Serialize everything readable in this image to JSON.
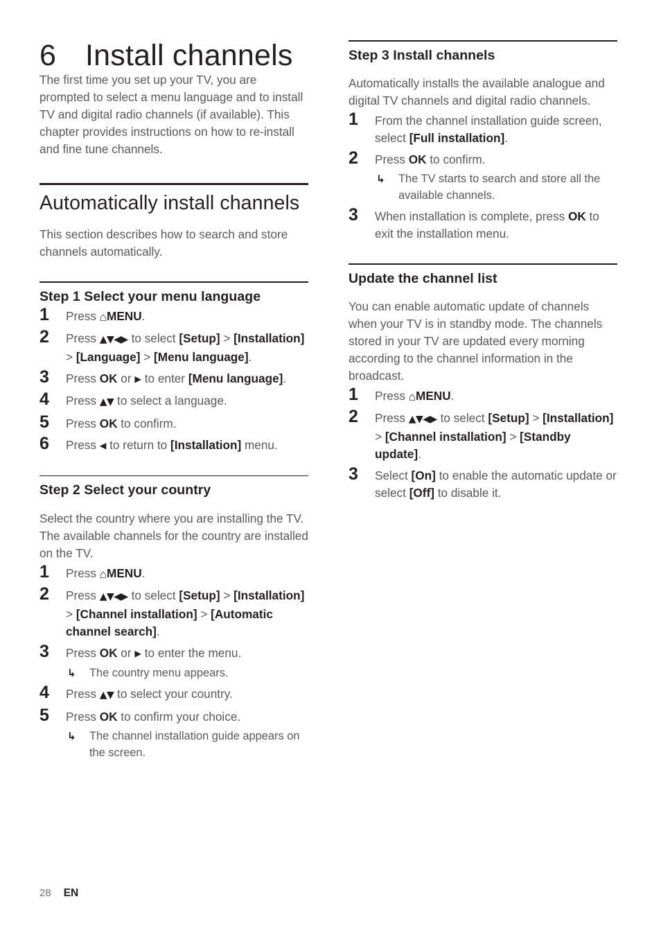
{
  "document": {
    "chapter_number": "6",
    "chapter_title": "Install channels",
    "intro": "The first time you set up your TV, you are prompted to select a menu language and to install TV and digital radio channels (if available). This chapter provides instructions on how to re-install and fine tune channels."
  },
  "glyphs": {
    "home": "⌂",
    "home_label": "home-icon",
    "updown": "▲▼",
    "updownleftright": "▲▼◀▶",
    "right": "▶",
    "left": "◀",
    "result_arrow": "↳"
  },
  "left_column": {
    "section": {
      "title": "Automatically install channels",
      "intro": "This section describes how to search and store channels automatically."
    },
    "step1": {
      "heading": "Step 1 Select your menu language",
      "items": [
        {
          "num": "1",
          "parts": [
            {
              "t": "text",
              "v": "Press "
            },
            {
              "t": "home",
              "v": "⌂"
            },
            {
              "t": "bold",
              "v": "MENU"
            },
            {
              "t": "text",
              "v": "."
            }
          ]
        },
        {
          "num": "2",
          "parts": [
            {
              "t": "text",
              "v": "Press "
            },
            {
              "t": "glyph",
              "v": "▲▼◀▶"
            },
            {
              "t": "text",
              "v": " to select "
            },
            {
              "t": "bold",
              "v": "[Setup]"
            },
            {
              "t": "text",
              "v": " > "
            },
            {
              "t": "bold",
              "v": "[Installation]"
            },
            {
              "t": "text",
              "v": " > "
            },
            {
              "t": "bold",
              "v": "[Language]"
            },
            {
              "t": "text",
              "v": " > "
            },
            {
              "t": "bold",
              "v": "[Menu language]"
            },
            {
              "t": "text",
              "v": "."
            }
          ]
        },
        {
          "num": "3",
          "parts": [
            {
              "t": "text",
              "v": "Press "
            },
            {
              "t": "bold",
              "v": "OK"
            },
            {
              "t": "text",
              "v": " or "
            },
            {
              "t": "glyph-single",
              "v": "▶"
            },
            {
              "t": "text",
              "v": " to enter "
            },
            {
              "t": "bold",
              "v": "[Menu language]"
            },
            {
              "t": "text",
              "v": "."
            }
          ]
        },
        {
          "num": "4",
          "parts": [
            {
              "t": "text",
              "v": "Press "
            },
            {
              "t": "glyph",
              "v": "▲▼"
            },
            {
              "t": "text",
              "v": " to select a language."
            }
          ]
        },
        {
          "num": "5",
          "parts": [
            {
              "t": "text",
              "v": "Press "
            },
            {
              "t": "bold",
              "v": "OK"
            },
            {
              "t": "text",
              "v": " to confirm."
            }
          ]
        },
        {
          "num": "6",
          "parts": [
            {
              "t": "text",
              "v": "Press "
            },
            {
              "t": "glyph-single",
              "v": "◀"
            },
            {
              "t": "text",
              "v": " to return to "
            },
            {
              "t": "bold",
              "v": "[Installation]"
            },
            {
              "t": "text",
              "v": " menu."
            }
          ]
        }
      ]
    },
    "step2": {
      "heading": "Step 2 Select your country",
      "intro": "Select the country where you are installing the TV. The available channels for the country are installed on the TV.",
      "items": [
        {
          "num": "1",
          "parts": [
            {
              "t": "text",
              "v": "Press "
            },
            {
              "t": "home",
              "v": "⌂"
            },
            {
              "t": "bold",
              "v": "MENU"
            },
            {
              "t": "text",
              "v": "."
            }
          ]
        },
        {
          "num": "2",
          "parts": [
            {
              "t": "text",
              "v": "Press "
            },
            {
              "t": "glyph",
              "v": "▲▼◀▶"
            },
            {
              "t": "text",
              "v": " to select "
            },
            {
              "t": "bold",
              "v": "[Setup]"
            },
            {
              "t": "text",
              "v": " > "
            },
            {
              "t": "bold",
              "v": "[Installation]"
            },
            {
              "t": "text",
              "v": " > "
            },
            {
              "t": "bold",
              "v": "[Channel installation]"
            },
            {
              "t": "text",
              "v": " > "
            },
            {
              "t": "bold",
              "v": "[Automatic channel search]"
            },
            {
              "t": "text",
              "v": "."
            }
          ]
        },
        {
          "num": "3",
          "parts": [
            {
              "t": "text",
              "v": "Press "
            },
            {
              "t": "bold",
              "v": "OK"
            },
            {
              "t": "text",
              "v": " or "
            },
            {
              "t": "glyph-single",
              "v": "▶"
            },
            {
              "t": "text",
              "v": " to enter the menu."
            }
          ],
          "results": [
            "The country menu appears."
          ]
        },
        {
          "num": "4",
          "parts": [
            {
              "t": "text",
              "v": "Press "
            },
            {
              "t": "glyph",
              "v": "▲▼"
            },
            {
              "t": "text",
              "v": " to select your country."
            }
          ]
        },
        {
          "num": "5",
          "parts": [
            {
              "t": "text",
              "v": "Press "
            },
            {
              "t": "bold",
              "v": "OK"
            },
            {
              "t": "text",
              "v": " to confirm your choice."
            }
          ],
          "results": [
            "The channel installation guide appears on the screen."
          ]
        }
      ]
    }
  },
  "right_column": {
    "step3": {
      "heading": "Step 3 Install channels",
      "intro": "Automatically installs the available analogue and digital TV channels and digital radio channels.",
      "items": [
        {
          "num": "1",
          "parts": [
            {
              "t": "text",
              "v": "From the channel installation guide screen, select "
            },
            {
              "t": "bold",
              "v": "[Full installation]"
            },
            {
              "t": "text",
              "v": "."
            }
          ]
        },
        {
          "num": "2",
          "parts": [
            {
              "t": "text",
              "v": "Press "
            },
            {
              "t": "bold",
              "v": "OK"
            },
            {
              "t": "text",
              "v": " to confirm."
            }
          ],
          "results": [
            "The TV starts to search and store all the available channels."
          ]
        },
        {
          "num": "3",
          "parts": [
            {
              "t": "text",
              "v": "When installation is complete, press "
            },
            {
              "t": "bold",
              "v": "OK"
            },
            {
              "t": "text",
              "v": " to exit the installation menu."
            }
          ]
        }
      ]
    },
    "update": {
      "heading": "Update the channel list",
      "intro": "You can enable automatic update of channels when your TV is in standby mode. The channels stored in your TV are updated every morning according to the channel information in the broadcast.",
      "items": [
        {
          "num": "1",
          "parts": [
            {
              "t": "text",
              "v": "Press "
            },
            {
              "t": "home",
              "v": "⌂"
            },
            {
              "t": "bold",
              "v": "MENU"
            },
            {
              "t": "text",
              "v": "."
            }
          ]
        },
        {
          "num": "2",
          "parts": [
            {
              "t": "text",
              "v": "Press "
            },
            {
              "t": "glyph",
              "v": "▲▼◀▶"
            },
            {
              "t": "text",
              "v": " to select "
            },
            {
              "t": "bold",
              "v": "[Setup]"
            },
            {
              "t": "text",
              "v": " > "
            },
            {
              "t": "bold",
              "v": "[Installation]"
            },
            {
              "t": "text",
              "v": " > "
            },
            {
              "t": "bold",
              "v": "[Channel installation]"
            },
            {
              "t": "text",
              "v": " > "
            },
            {
              "t": "bold",
              "v": "[Standby update]"
            },
            {
              "t": "text",
              "v": "."
            }
          ]
        },
        {
          "num": "3",
          "parts": [
            {
              "t": "text",
              "v": "Select "
            },
            {
              "t": "bold",
              "v": "[On]"
            },
            {
              "t": "text",
              "v": " to enable the automatic update or select "
            },
            {
              "t": "bold",
              "v": "[Off]"
            },
            {
              "t": "text",
              "v": " to disable it."
            }
          ]
        }
      ]
    }
  },
  "footer": {
    "page": "28",
    "language": "EN"
  },
  "colors": {
    "text_dark": "#231f20",
    "text_body": "#58595b",
    "rule": "#231f20",
    "background": "#ffffff"
  }
}
